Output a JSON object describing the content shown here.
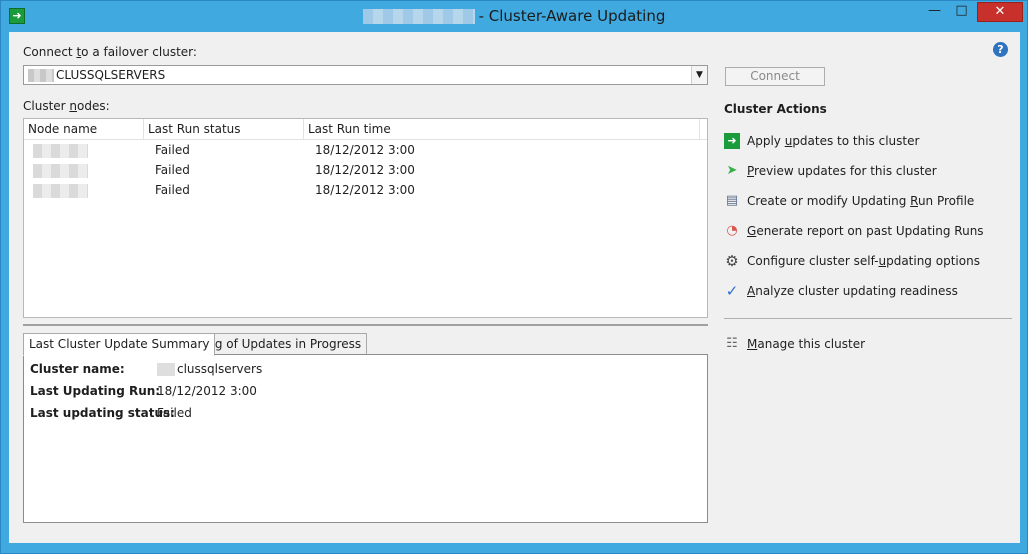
{
  "window": {
    "title": "- Cluster-Aware Updating",
    "minimize_glyph": "—",
    "maximize_glyph": "□",
    "close_glyph": "✕",
    "help_glyph": "?"
  },
  "connect": {
    "label_pre": "Connect ",
    "label_key": "t",
    "label_post": "o a failover cluster:",
    "cluster_value": "CLUSSQLSERVERS",
    "button_label": "Connect"
  },
  "nodes": {
    "label_pre": "Cluster ",
    "label_key": "n",
    "label_post": "odes:",
    "columns": [
      "Node name",
      "Last Run status",
      "Last Run time"
    ],
    "rows": [
      {
        "status": "Failed",
        "time": "18/12/2012 3:00"
      },
      {
        "status": "Failed",
        "time": "18/12/2012 3:00"
      },
      {
        "status": "Failed",
        "time": "18/12/2012 3:00"
      }
    ]
  },
  "tabs": [
    {
      "label": "Last Cluster Update Summary",
      "active": true
    },
    {
      "label": "Log of Updates in Progress",
      "active": false
    }
  ],
  "summary": {
    "cluster_name_label": "Cluster name:",
    "cluster_name_value": "clussqlservers",
    "last_run_label": "Last Updating Run:",
    "last_run_value": "18/12/2012 3:00",
    "last_status_label": "Last updating status:",
    "last_status_value": "Failed"
  },
  "actions": {
    "title": "Cluster Actions",
    "items": [
      {
        "pre": "Apply ",
        "key": "u",
        "post": "pdates to this cluster",
        "icon": "apply-updates-icon",
        "color": "#1b9c3c"
      },
      {
        "pre": "",
        "key": "P",
        "post": "review updates for this cluster",
        "icon": "preview-arrow-icon",
        "color": "#3bb04a"
      },
      {
        "pre": "Create or modify Updating ",
        "key": "R",
        "post": "un Profile",
        "icon": "document-icon",
        "color": "#5a6e8a"
      },
      {
        "pre": "",
        "key": "G",
        "post": "enerate report on past Updating Runs",
        "icon": "report-icon",
        "color": "#d9534f"
      },
      {
        "pre": "Configure cluster self-updating options",
        "key": "",
        "post": "",
        "icon": "gear-icon",
        "color": "#444444"
      },
      {
        "pre": "",
        "key": "A",
        "post": "nalyze cluster updating readiness",
        "icon": "checkmark-icon",
        "color": "#2f6fd0"
      }
    ],
    "manage": {
      "pre": "",
      "key": "M",
      "post": "anage this cluster",
      "icon": "server-manager-icon"
    }
  }
}
